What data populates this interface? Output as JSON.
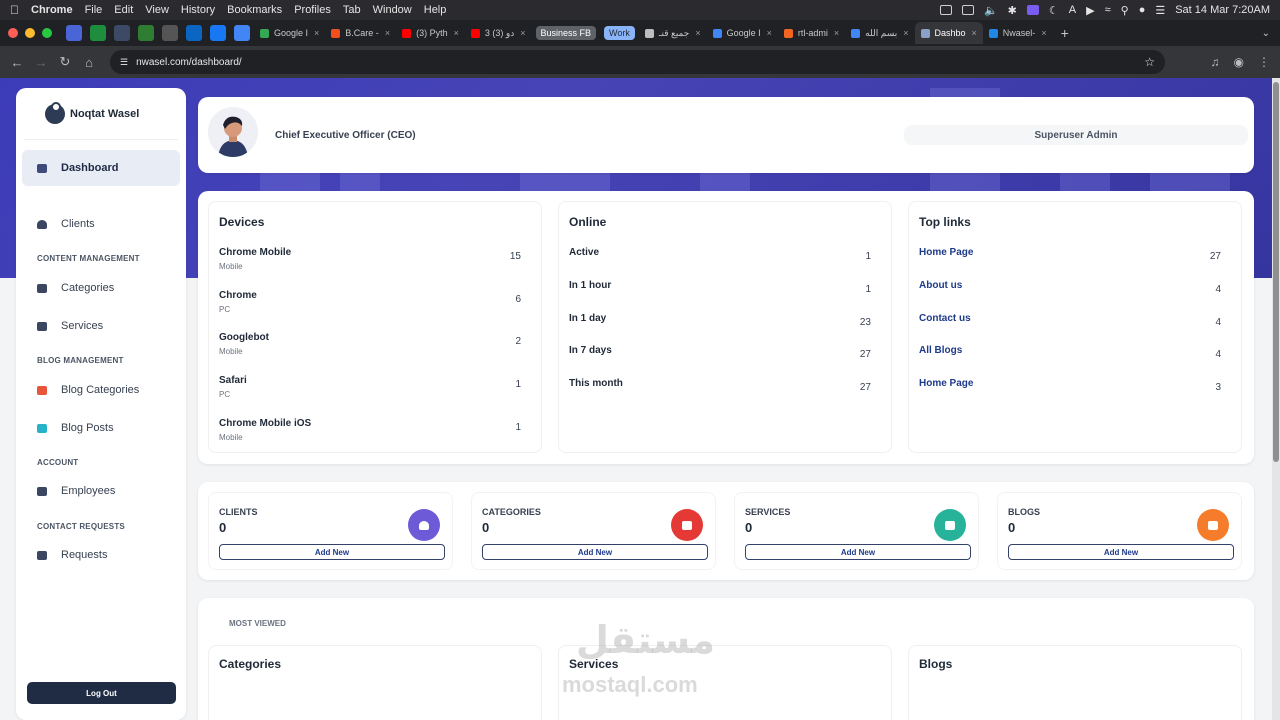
{
  "menubar": {
    "app": "Chrome",
    "items": [
      "File",
      "Edit",
      "View",
      "History",
      "Bookmarks",
      "Profiles",
      "Tab",
      "Window",
      "Help"
    ],
    "datetime": "Sat 14 Mar  7:20AM"
  },
  "tabs": [
    {
      "label": "Google I",
      "color": "#34a853"
    },
    {
      "label": "B.Care -",
      "color": "#f24e1e"
    },
    {
      "label": "(3) Pyth",
      "color": "#ff0000"
    },
    {
      "label": "3 (3) دو",
      "color": "#ff0000"
    },
    {
      "label": "جميع قنـ",
      "color": "#bdbdbd"
    },
    {
      "label": "Google I",
      "color": "#4285f4"
    },
    {
      "label": "rtl-admi",
      "color": "#f26522"
    },
    {
      "label": "بسم الله",
      "color": "#4285f4"
    },
    {
      "label": "Dashbo",
      "color": "#1f2c44",
      "active": true
    },
    {
      "label": "Nwasel-",
      "color": "#1e88e5"
    }
  ],
  "tab_groups": [
    {
      "label": "Business FB",
      "color": "#5f6368"
    },
    {
      "label": "Work",
      "color": "#8ab4f8"
    }
  ],
  "url": "nwasel.com/dashboard/",
  "sidebar": {
    "brand": "Noqtat Wasel",
    "dashboard": "Dashboard",
    "clients": "Clients",
    "content_section": "CONTENT MANAGEMENT",
    "categories": "Categories",
    "services": "Services",
    "blog_section": "BLOG MANAGEMENT",
    "blog_categories": "Blog Categories",
    "blog_posts": "Blog Posts",
    "account_section": "ACCOUNT",
    "employees": "Employees",
    "contact_section": "CONTACT REQUESTS",
    "requests": "Requests",
    "logout": "Log Out"
  },
  "profile": {
    "job_title": "Chief Executive Officer (CEO)",
    "user_name": "Superuser Admin"
  },
  "devices": {
    "title": "Devices",
    "rows": [
      {
        "name": "Chrome Mobile",
        "type": "Mobile",
        "count": "15"
      },
      {
        "name": "Chrome",
        "type": "PC",
        "count": "6"
      },
      {
        "name": "Googlebot",
        "type": "Mobile",
        "count": "2"
      },
      {
        "name": "Safari",
        "type": "PC",
        "count": "1"
      },
      {
        "name": "Chrome Mobile iOS",
        "type": "Mobile",
        "count": "1"
      }
    ]
  },
  "online": {
    "title": "Online",
    "rows": [
      {
        "label": "Active",
        "count": "1"
      },
      {
        "label": "In 1 hour",
        "count": "1"
      },
      {
        "label": "In 1 day",
        "count": "23"
      },
      {
        "label": "In 7 days",
        "count": "27"
      },
      {
        "label": "This month",
        "count": "27"
      }
    ]
  },
  "top_links": {
    "title": "Top links",
    "rows": [
      {
        "label": "Home Page",
        "count": "27"
      },
      {
        "label": "About us",
        "count": "4"
      },
      {
        "label": "Contact us",
        "count": "4"
      },
      {
        "label": "All Blogs",
        "count": "4"
      },
      {
        "label": "Home Page",
        "count": "3"
      }
    ]
  },
  "counters": [
    {
      "title": "CLIENTS",
      "count": "0",
      "button": "Add New",
      "color": "#6d5ad6"
    },
    {
      "title": "CATEGORIES",
      "count": "0",
      "button": "Add New",
      "color": "#e53935"
    },
    {
      "title": "SERVICES",
      "count": "0",
      "button": "Add New",
      "color": "#26b39a"
    },
    {
      "title": "BLOGS",
      "count": "0",
      "button": "Add New",
      "color": "#f57c2a"
    }
  ],
  "most_viewed": {
    "title": "MOST VIEWED",
    "categories": "Categories",
    "services": "Services",
    "blogs": "Blogs"
  },
  "watermark": {
    "arabic": "مستقل",
    "latin": "mostaql.com"
  }
}
